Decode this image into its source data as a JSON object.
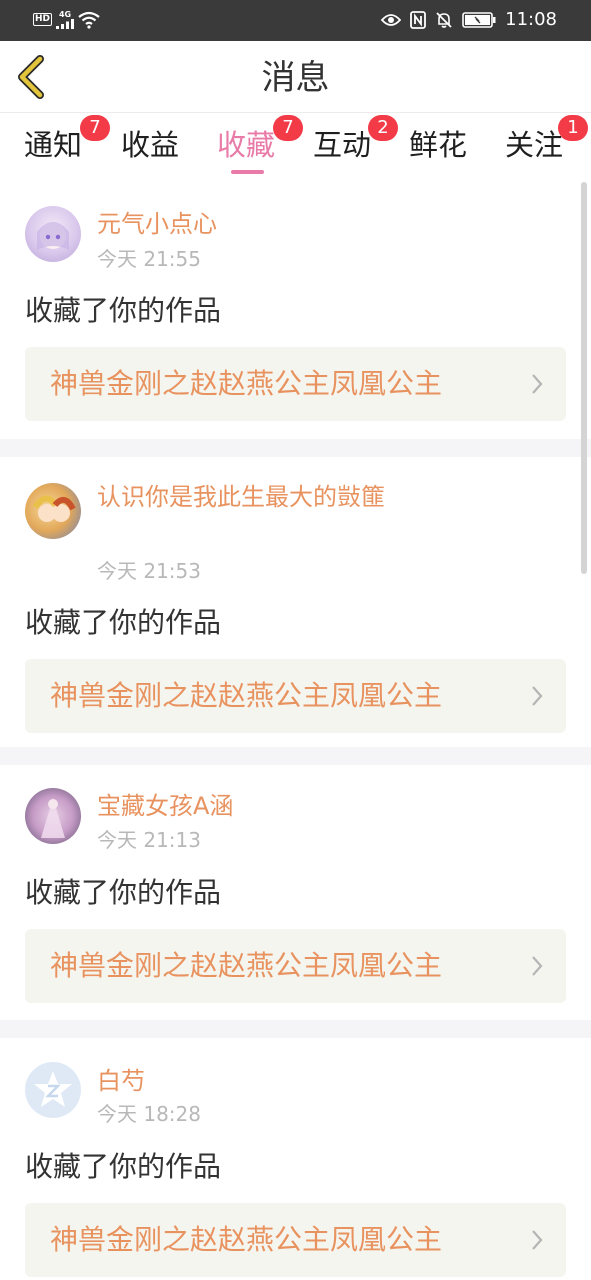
{
  "status_bar": {
    "hd": "HD",
    "network": "4G",
    "time": "11:08",
    "icons": [
      "hd-icon",
      "signal-icon",
      "wifi-icon",
      "eye-icon",
      "nfc-icon",
      "mute-icon",
      "battery-icon"
    ]
  },
  "header": {
    "title": "消息",
    "back_icon": "chevron-left-icon"
  },
  "tabs": [
    {
      "label": "通知",
      "badge": "7",
      "active": false
    },
    {
      "label": "收益",
      "badge": null,
      "active": false
    },
    {
      "label": "收藏",
      "badge": "7",
      "active": true
    },
    {
      "label": "互动",
      "badge": "2",
      "active": false
    },
    {
      "label": "鲜花",
      "badge": null,
      "active": false
    },
    {
      "label": "关注",
      "badge": "1",
      "active": false
    }
  ],
  "feed": [
    {
      "user": "元气小点心",
      "time": "今天 21:55",
      "action": "收藏了你的作品",
      "work": "神兽金刚之赵赵燕公主凤凰公主"
    },
    {
      "user": "认识你是我此生最大的敱篚",
      "time": "今天 21:53",
      "action": "收藏了你的作品",
      "work": "神兽金刚之赵赵燕公主凤凰公主"
    },
    {
      "user": "宝藏女孩A涵",
      "time": "今天 21:13",
      "action": "收藏了你的作品",
      "work": "神兽金刚之赵赵燕公主凤凰公主"
    },
    {
      "user": "白芍",
      "time": "今天 18:28",
      "action": "收藏了你的作品",
      "work": "神兽金刚之赵赵燕公主凤凰公主"
    }
  ],
  "colors": {
    "accent": "#e87ba7",
    "name": "#e8935f",
    "badge": "#f23b47",
    "back_arrow": "#e2c53a"
  }
}
